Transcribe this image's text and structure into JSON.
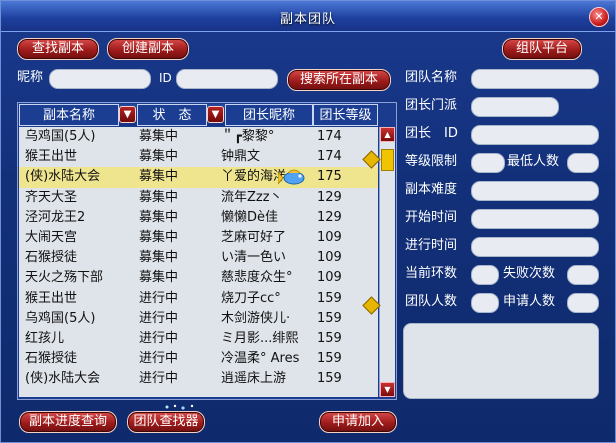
{
  "window": {
    "title": "副本团队"
  },
  "top_buttons": {
    "find": "查找副本",
    "create": "创建副本",
    "platform": "组队平台"
  },
  "search": {
    "nickname_label": "昵称",
    "id_label": "ID",
    "search_button": "搜索所在副本"
  },
  "table": {
    "headers": [
      "副本名称",
      "状　态",
      "团长昵称",
      "团长等级"
    ],
    "rows": [
      {
        "name": "乌鸡国(5人)",
        "status": "募集中",
        "leader": "＂┏黎黎°",
        "level": "174"
      },
      {
        "name": "猴王出世",
        "status": "募集中",
        "leader": "钟鼎文",
        "level": "174"
      },
      {
        "name": "(侠)水陆大会",
        "status": "募集中",
        "leader": "丫爱的海洋",
        "level": "175"
      },
      {
        "name": "齐天大圣",
        "status": "募集中",
        "leader": "流年Zzz丶",
        "level": "129"
      },
      {
        "name": "泾河龙王2",
        "status": "募集中",
        "leader": "懒懒Dè佳",
        "level": "129"
      },
      {
        "name": "大闹天宫",
        "status": "募集中",
        "leader": "芝麻可好了",
        "level": "109"
      },
      {
        "name": "石猴授徒",
        "status": "募集中",
        "leader": "い清一色い",
        "level": "109"
      },
      {
        "name": "天火之殇下部",
        "status": "募集中",
        "leader": "慈悲度众生°",
        "level": "109"
      },
      {
        "name": "猴王出世",
        "status": "进行中",
        "leader": "烧刀子cc°",
        "level": "159"
      },
      {
        "name": "乌鸡国(5人)",
        "status": "进行中",
        "leader": "木剑游侠儿·",
        "level": "159"
      },
      {
        "name": "红孩儿",
        "status": "进行中",
        "leader": "ミ月影...绯熙",
        "level": "159"
      },
      {
        "name": "石猴授徒",
        "status": "进行中",
        "leader": "冷温柔° Ares",
        "level": "159"
      },
      {
        "name": "(侠)水陆大会",
        "status": "进行中",
        "leader": "逍遥床上游",
        "level": "159"
      }
    ]
  },
  "info": {
    "team_name": "团队名称",
    "leader_school": "团长门派",
    "leader_id": "团长　ID",
    "level_limit": "等级限制",
    "min_players": "最低人数",
    "difficulty": "副本难度",
    "start_time": "开始时间",
    "elapsed_time": "进行时间",
    "current_round": "当前环数",
    "fail_count": "失败次数",
    "team_size": "团队人数",
    "applicants": "申请人数"
  },
  "bottom_buttons": {
    "progress": "副本进度查询",
    "finder": "团队查找器",
    "apply": "申请加入"
  },
  "colors": {
    "selected_row": "#efe58f",
    "button_red": "#9f1b1b",
    "panel_blue": "#12307a"
  }
}
